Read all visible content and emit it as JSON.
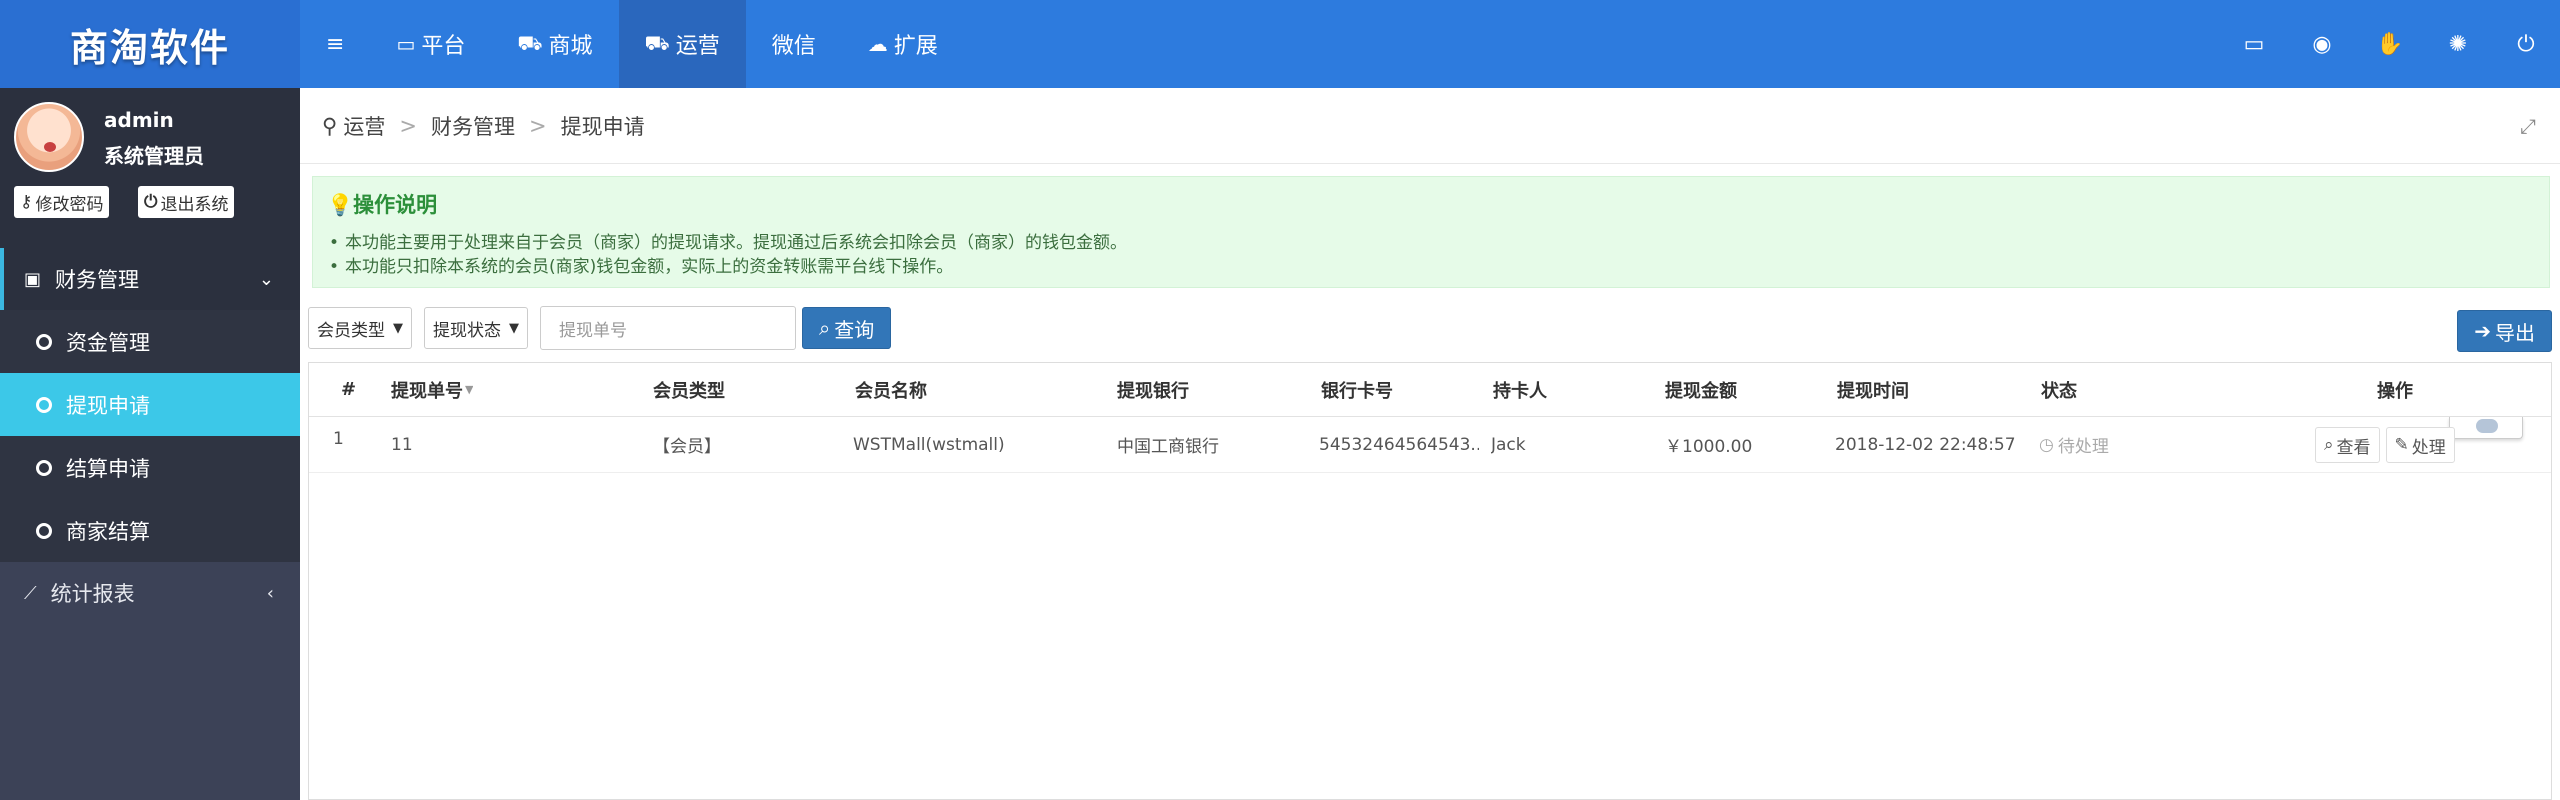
{
  "app": {
    "logo": "商淘软件"
  },
  "topnav": [
    {
      "label": "平台",
      "icon": "monitor-icon"
    },
    {
      "label": "商城",
      "icon": "cart-icon"
    },
    {
      "label": "运营",
      "icon": "truck-icon",
      "active": true
    },
    {
      "label": "微信",
      "icon": ""
    },
    {
      "label": "扩展",
      "icon": "cloud-icon"
    }
  ],
  "toolbar": [
    "desktop-icon",
    "location-icon",
    "handshake-icon",
    "spinner-icon",
    "power-icon"
  ],
  "user": {
    "name": "admin",
    "role": "系统管理员",
    "change_password": "修改密码",
    "logout": "退出系统"
  },
  "sidebar": {
    "finance_group": "财务管理",
    "items": [
      {
        "label": "资金管理"
      },
      {
        "label": "提现申请",
        "active": true
      },
      {
        "label": "结算申请"
      },
      {
        "label": "商家结算"
      }
    ],
    "stats_group": "统计报表"
  },
  "breadcrumb": {
    "root": "运营",
    "parent": "财务管理",
    "current": "提现申请"
  },
  "notice": {
    "title": "操作说明",
    "lines": [
      "本功能主要用于处理来自于会员（商家）的提现请求。提现通过后系统会扣除会员（商家）的钱包金额。",
      "本功能只扣除本系统的会员(商家)钱包金额，实际上的资金转账需平台线下操作。"
    ]
  },
  "filters": {
    "member_type": "会员类型",
    "withdraw_status": "提现状态",
    "order_placeholder": "提现单号",
    "search_label": "查询",
    "export_label": "导出"
  },
  "table": {
    "headers": [
      "#",
      "提现单号",
      "会员类型",
      "会员名称",
      "提现银行",
      "银行卡号",
      "持卡人",
      "提现金额",
      "提现时间",
      "状态",
      "操作"
    ],
    "rows": [
      {
        "index": "1",
        "order_no": "11",
        "member_type": "【会员】",
        "member_name": "WSTMall(wstmall)",
        "bank": "中国工商银行",
        "card_no": "54532464564543...",
        "holder": "Jack",
        "amount": "￥1000.00",
        "time": "2018-12-02 22:48:57",
        "status": "待处理",
        "view_label": "查看",
        "process_label": "处理"
      }
    ]
  },
  "colors": {
    "topbar": "#2d7bde",
    "sidebar": "#3c4257",
    "active_item": "#3cc8e8",
    "primary_button": "#3276b8"
  }
}
